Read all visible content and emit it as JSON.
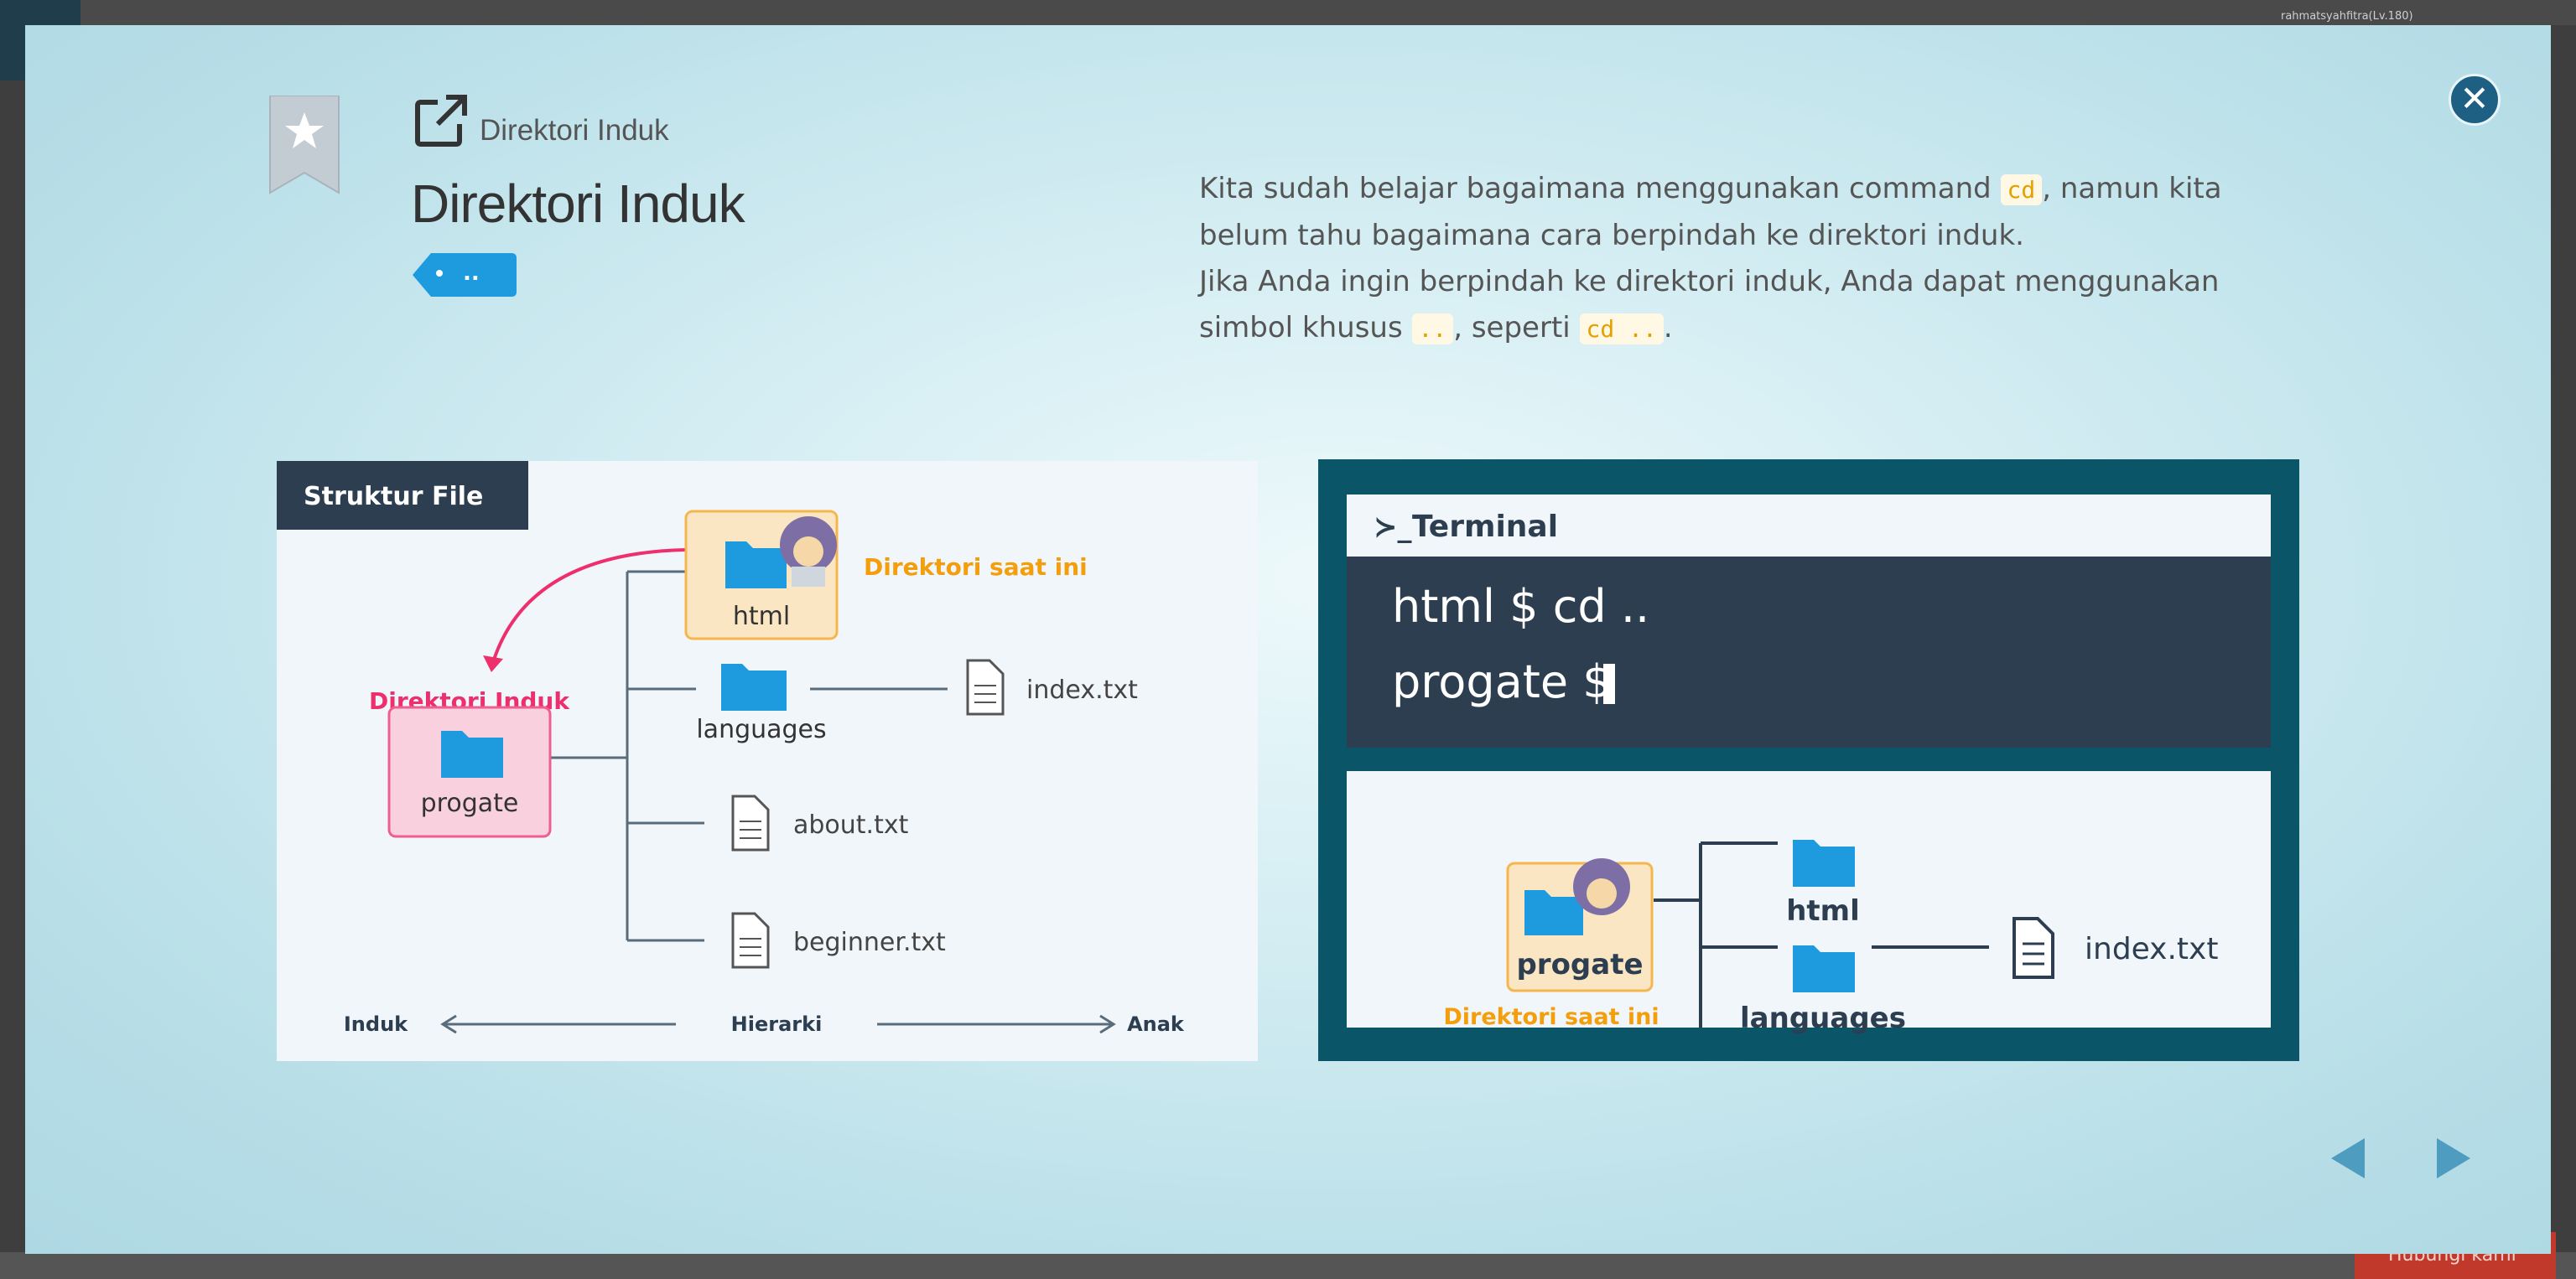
{
  "backdrop": {
    "username": "rahmatsyahfitra(Lv.180)",
    "hint_button": "Hubungi kami"
  },
  "slide": {
    "subtitle": "Direktori Induk",
    "title": "Direktori Induk",
    "tag": "..",
    "description": {
      "p1_before": "Kita sudah belajar bagaimana menggunakan command ",
      "p1_code": "cd",
      "p1_after": ", namun kita belum tahu bagaimana cara berpindah ke direktori induk.",
      "p2_before": "Jika Anda ingin berpindah ke direktori induk, Anda dapat menggunakan simbol khusus ",
      "p2_code1": "..",
      "p2_mid": ", seperti ",
      "p2_code2": "cd ..",
      "p2_after": "."
    }
  },
  "left_diagram": {
    "header": "Struktur File",
    "current_label": "Direktori saat ini",
    "parent_label": "Direktori Induk",
    "folders": {
      "html": "html",
      "languages": "languages",
      "progate": "progate"
    },
    "files": {
      "index": "index.txt",
      "about": "about.txt",
      "beginner": "beginner.txt"
    },
    "axis": {
      "left": "Induk",
      "middle": "Hierarki",
      "right": "Anak"
    }
  },
  "right_diagram": {
    "terminal_title": "Terminal",
    "prompt_symbol": "≻_",
    "line1": "html $ cd ..",
    "line2": "progate $",
    "current_label": "Direktori saat ini",
    "folders": {
      "progate": "progate",
      "html": "html",
      "languages": "languages"
    },
    "files": {
      "index": "index.txt"
    }
  },
  "colors": {
    "accent_blue": "#1e9bdf",
    "pink": "#ee2f6e",
    "orange": "#f59e0b",
    "dark_navy": "#2c3e50",
    "teal": "#0b5569"
  },
  "icons": {
    "close": "close-icon",
    "bookmark": "bookmark-star-icon",
    "external": "external-link-icon",
    "prev": "arrow-left-icon",
    "next": "arrow-right-icon"
  }
}
